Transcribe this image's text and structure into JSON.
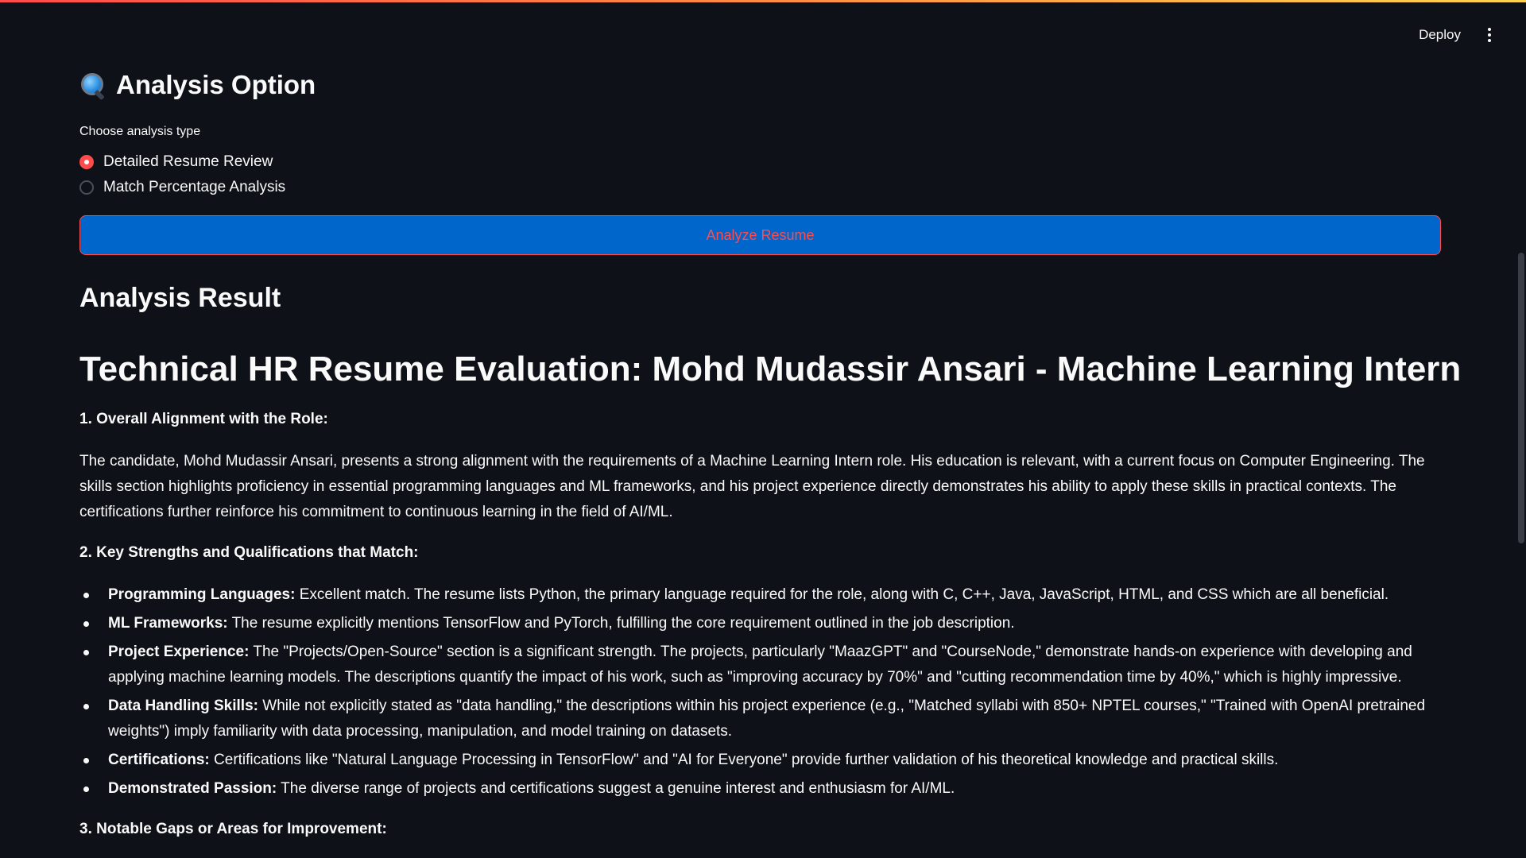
{
  "header": {
    "deploy_label": "Deploy",
    "menu_icon": "kebab-menu-icon"
  },
  "analysis_option": {
    "title": "Analysis Option",
    "icon": "magnifier-icon",
    "choose_label": "Choose analysis type",
    "options": [
      {
        "label": "Detailed Resume Review",
        "selected": true
      },
      {
        "label": "Match Percentage Analysis",
        "selected": false
      }
    ],
    "analyze_button": "Analyze Resume"
  },
  "result": {
    "heading": "Analysis Result",
    "title": "Technical HR Resume Evaluation: Mohd Mudassir Ansari - Machine Learning Intern",
    "section1_heading": "1. Overall Alignment with the Role:",
    "section1_paragraph": "The candidate, Mohd Mudassir Ansari, presents a strong alignment with the requirements of a Machine Learning Intern role. His education is relevant, with a current focus on Computer Engineering. The skills section highlights proficiency in essential programming languages and ML frameworks, and his project experience directly demonstrates his ability to apply these skills in practical contexts. The certifications further reinforce his commitment to continuous learning in the field of AI/ML.",
    "section2_heading": "2. Key Strengths and Qualifications that Match:",
    "strengths": [
      {
        "label": "Programming Languages:",
        "text": " Excellent match. The resume lists Python, the primary language required for the role, along with C, C++, Java, JavaScript, HTML, and CSS which are all beneficial."
      },
      {
        "label": "ML Frameworks:",
        "text": " The resume explicitly mentions TensorFlow and PyTorch, fulfilling the core requirement outlined in the job description."
      },
      {
        "label": "Project Experience:",
        "text": " The \"Projects/Open-Source\" section is a significant strength. The projects, particularly \"MaazGPT\" and \"CourseNode,\" demonstrate hands-on experience with developing and applying machine learning models. The descriptions quantify the impact of his work, such as \"improving accuracy by 70%\" and \"cutting recommendation time by 40%,\" which is highly impressive."
      },
      {
        "label": "Data Handling Skills:",
        "text": " While not explicitly stated as \"data handling,\" the descriptions within his project experience (e.g., \"Matched syllabi with 850+ NPTEL courses,\" \"Trained with OpenAI pretrained weights\") imply familiarity with data processing, manipulation, and model training on datasets."
      },
      {
        "label": "Certifications:",
        "text": " Certifications like \"Natural Language Processing in TensorFlow\" and \"AI for Everyone\" provide further validation of his theoretical knowledge and practical skills."
      },
      {
        "label": "Demonstrated Passion:",
        "text": " The diverse range of projects and certifications suggest a genuine interest and enthusiasm for AI/ML."
      }
    ],
    "section3_heading": "3. Notable Gaps or Areas for Improvement:"
  },
  "colors": {
    "background": "#0e1117",
    "accent": "#ff4b4b",
    "button_bg": "#0066cc",
    "text": "#fafafa"
  }
}
